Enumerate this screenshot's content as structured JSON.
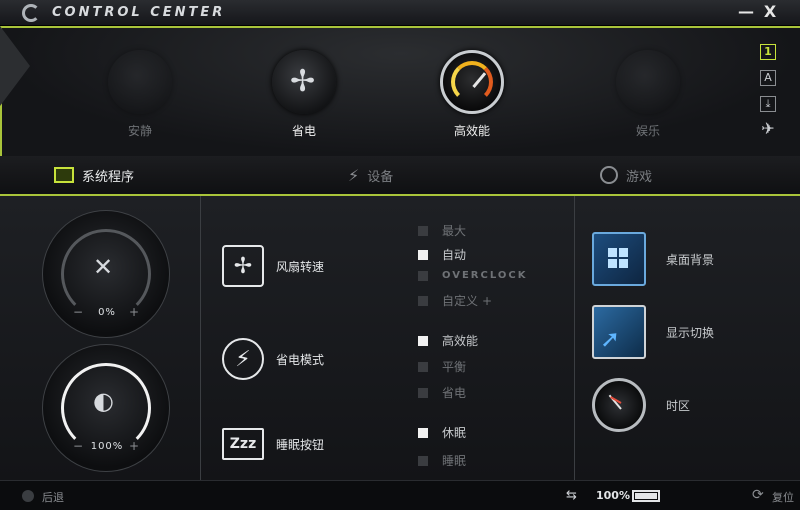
{
  "window": {
    "title": "CONTROL CENTER",
    "minimize": "—",
    "close": "X"
  },
  "modes": [
    {
      "label": "安静",
      "icon": "speaker-icon",
      "state": "dim"
    },
    {
      "label": "省电",
      "icon": "fan-icon",
      "state": "bright"
    },
    {
      "label": "高效能",
      "icon": "gauge-icon",
      "state": "selected"
    },
    {
      "label": "娱乐",
      "icon": "crosshair-icon",
      "state": "dim"
    }
  ],
  "side_icons": [
    {
      "glyph": "1",
      "name": "profile-1-icon",
      "active": true
    },
    {
      "glyph": "A",
      "name": "profile-a-icon",
      "active": false
    },
    {
      "glyph": "⤓",
      "name": "download-icon",
      "active": false
    },
    {
      "glyph": "✈",
      "name": "airplane-icon",
      "active": false
    }
  ],
  "tabs": {
    "system": "系统程序",
    "device": "设备",
    "game": "游戏"
  },
  "knobs": {
    "fan": {
      "value": "0%",
      "minus": "−",
      "plus": "+"
    },
    "brightness": {
      "value": "100%",
      "minus": "−",
      "plus": "+"
    }
  },
  "features": {
    "fan_speed": "风扇转速",
    "power_mode": "省电模式",
    "sleep_button": "睡眠按钮",
    "sleep_icon_text": "Zzz"
  },
  "fan_options": [
    {
      "label": "最大",
      "checked": false
    },
    {
      "label": "自动",
      "checked": true
    },
    {
      "label": "OVERCLOCK",
      "checked": false
    },
    {
      "label": "自定义",
      "checked": false
    }
  ],
  "power_options": [
    {
      "label": "高效能",
      "checked": true
    },
    {
      "label": "平衡",
      "checked": false
    },
    {
      "label": "省电",
      "checked": false
    }
  ],
  "sleep_options": [
    {
      "label": "休眠",
      "checked": true
    },
    {
      "label": "睡眠",
      "checked": false
    }
  ],
  "tiles": {
    "desktop_bg": "桌面背景",
    "display_switch": "显示切换",
    "timezone": "时区"
  },
  "status": {
    "back": "后退",
    "battery": "100%",
    "battery_level": 1.0,
    "reset": "复位"
  },
  "colors": {
    "accent": "#a9c43a",
    "gauge_orange": "#f1b21d"
  }
}
